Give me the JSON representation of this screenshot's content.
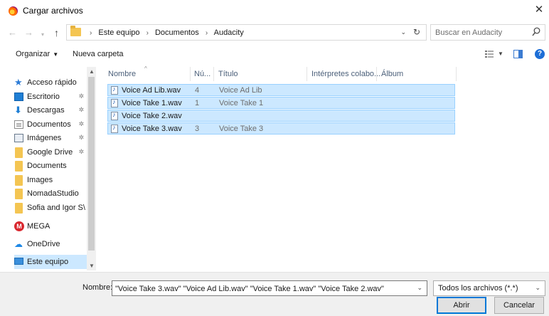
{
  "window": {
    "title": "Cargar archivos",
    "close_glyph": "✕"
  },
  "nav": {
    "back_glyph": "←",
    "forward_glyph": "→",
    "recent_glyph": "▾",
    "up_glyph": "↑"
  },
  "address": {
    "crumbs": [
      "Este equipo",
      "Documentos",
      "Audacity"
    ],
    "separator": "›",
    "dropdown_glyph": "⌄",
    "refresh_glyph": "↻"
  },
  "search": {
    "placeholder": "Buscar en Audacity"
  },
  "toolbar": {
    "organize_label": "Organizar",
    "organize_caret": "▼",
    "new_folder_label": "Nueva carpeta",
    "view_caret": "▼",
    "help_label": "?"
  },
  "sidebar": {
    "pin_glyph": "✲",
    "items": [
      {
        "label": "Acceso rápido",
        "icon": "star-icon"
      },
      {
        "label": "Escritorio",
        "icon": "desktop-icon",
        "pinned": true
      },
      {
        "label": "Descargas",
        "icon": "download-icon",
        "pinned": true
      },
      {
        "label": "Documentos",
        "icon": "document-icon",
        "pinned": true
      },
      {
        "label": "Imágenes",
        "icon": "image-icon",
        "pinned": true
      },
      {
        "label": "Google Drive",
        "icon": "folder-icon",
        "pinned": true
      },
      {
        "label": "Documents",
        "icon": "folder-icon"
      },
      {
        "label": "Images",
        "icon": "folder-icon"
      },
      {
        "label": "NomadaStudio",
        "icon": "folder-icon"
      },
      {
        "label": "Sofia and Igor S\\",
        "icon": "folder-icon"
      },
      {
        "label": "MEGA",
        "icon": "mega-icon"
      },
      {
        "label": "OneDrive",
        "icon": "cloud-icon"
      },
      {
        "label": "Este equipo",
        "icon": "computer-icon",
        "selected": true
      }
    ],
    "mega_letter": "M",
    "star_glyph": "★",
    "download_glyph": "⬇",
    "cloud_glyph": "☁",
    "scroll_up_glyph": "▲",
    "scroll_down_glyph": "▼"
  },
  "files": {
    "sort_glyph": "^",
    "columns": [
      "Nombre",
      "Nú...",
      "Título",
      "Intérpretes colabo...",
      "Álbum"
    ],
    "rows": [
      {
        "name": "Voice Ad Lib.wav",
        "num": "4",
        "title": "Voice Ad Lib",
        "selected": true
      },
      {
        "name": "Voice Take 1.wav",
        "num": "1",
        "title": "Voice Take 1",
        "selected": true
      },
      {
        "name": "Voice Take 2.wav",
        "num": "",
        "title": "",
        "selected": true
      },
      {
        "name": "Voice Take 3.wav",
        "num": "3",
        "title": "Voice Take 3",
        "selected": true
      }
    ]
  },
  "footer": {
    "filename_label": "Nombre:",
    "filename_value": "\"Voice Take 3.wav\" \"Voice Ad Lib.wav\" \"Voice Take 1.wav\" \"Voice Take 2.wav\"",
    "filetype_value": "Todos los archivos (*.*)",
    "dropdown_glyph": "⌄",
    "open_label": "Abrir",
    "cancel_label": "Cancelar"
  },
  "colors": {
    "selection_bg": "#cce8ff",
    "selection_border": "#99d1ff",
    "accent": "#0078d7"
  }
}
